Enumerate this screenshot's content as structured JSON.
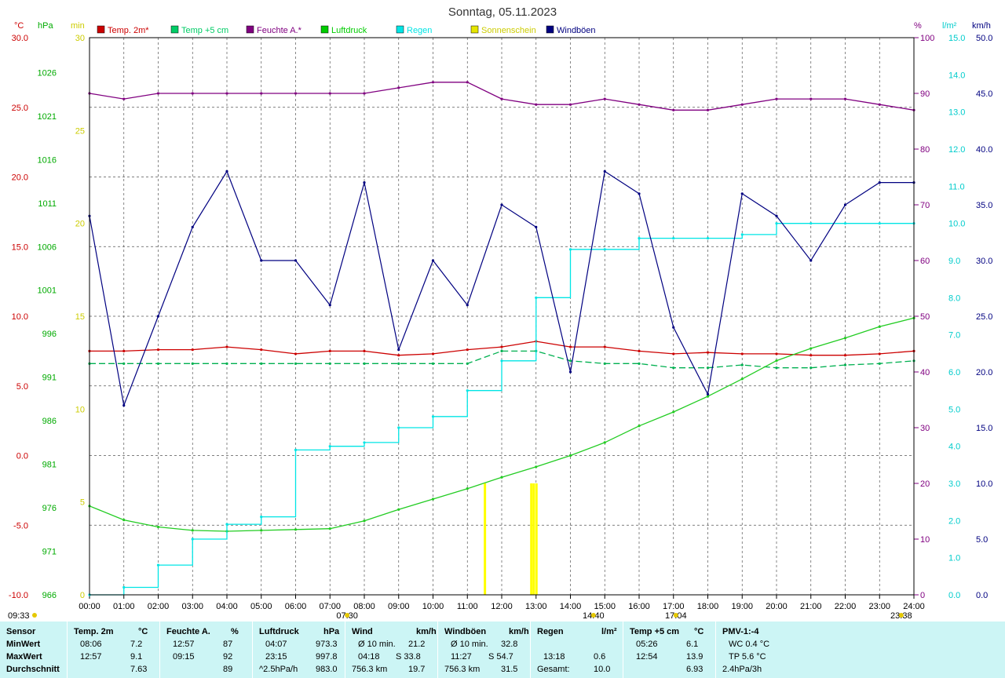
{
  "title": "Sonntag, 05.11.2023",
  "axis_units": {
    "temp": "°C",
    "pressure": "hPa",
    "sun": "min",
    "humidity": "%",
    "rain": "l/m²",
    "wind": "km/h"
  },
  "axis_labels": {
    "temp": [
      "30.0",
      "25.0",
      "20.0",
      "15.0",
      "10.0",
      "5.0",
      "0.0",
      "-5.0",
      "-10.0"
    ],
    "pressure": [
      "1026",
      "1021",
      "1016",
      "1011",
      "1006",
      "1001",
      "996",
      "991",
      "986",
      "981",
      "976",
      "971",
      "966"
    ],
    "sun": [
      "30",
      "25",
      "20",
      "15",
      "10",
      "5",
      "0"
    ],
    "humidity": [
      "100",
      "90",
      "80",
      "70",
      "60",
      "50",
      "40",
      "30",
      "20",
      "10",
      "0"
    ],
    "rain": [
      "15.0",
      "14.0",
      "13.0",
      "12.0",
      "11.0",
      "10.0",
      "9.0",
      "8.0",
      "7.0",
      "6.0",
      "5.0",
      "4.0",
      "3.0",
      "2.0",
      "1.0",
      "0.0"
    ],
    "wind": [
      "50.0",
      "45.0",
      "40.0",
      "35.0",
      "30.0",
      "25.0",
      "20.0",
      "15.0",
      "10.0",
      "5.0",
      "0.0"
    ]
  },
  "x_ticks": [
    "00:00",
    "01:00",
    "02:00",
    "03:00",
    "04:00",
    "05:00",
    "06:00",
    "07:00",
    "08:00",
    "09:00",
    "10:00",
    "11:00",
    "12:00",
    "13:00",
    "14:00",
    "15:00",
    "16:00",
    "17:00",
    "18:00",
    "19:00",
    "20:00",
    "21:00",
    "22:00",
    "23:00",
    "24:00"
  ],
  "x_annotations": [
    {
      "label": "07:30",
      "hour": 7.5
    },
    {
      "label": "17:04",
      "hour": 17.07
    },
    {
      "label": "14:40",
      "hour": 14.67
    },
    {
      "label": "23:38",
      "hour": 23.63
    }
  ],
  "x_left_note": "09:33",
  "colors": {
    "temp2m": "#cc0000",
    "temp5cm": "#00b050",
    "humidity": "#800080",
    "pressure": "#22cc22",
    "rain": "#00e5e5",
    "sun": "#ffff00",
    "gusts": "#000080",
    "grid": "#808080",
    "panel": "#ccf5f5"
  },
  "legend": [
    {
      "label": "Temp. 2m*",
      "color": "#cc0000"
    },
    {
      "label": "Temp +5 cm",
      "color": "#00cc66"
    },
    {
      "label": "Feuchte A.*",
      "color": "#800080"
    },
    {
      "label": "Luftdruck",
      "color": "#00cc00"
    },
    {
      "label": "Regen",
      "color": "#00e5e5"
    },
    {
      "label": "Sonnenschein",
      "color": "#e5e500"
    },
    {
      "label": "Windböen",
      "color": "#000080"
    }
  ],
  "chart_data": {
    "type": "line",
    "x": [
      0,
      1,
      2,
      3,
      4,
      5,
      6,
      7,
      8,
      9,
      10,
      11,
      12,
      13,
      14,
      15,
      16,
      17,
      18,
      19,
      20,
      21,
      22,
      23,
      24
    ],
    "xlabel": "",
    "series": [
      {
        "name": "Temp. 2m*",
        "axis": "temp",
        "values": [
          7.5,
          7.5,
          7.6,
          7.6,
          7.8,
          7.6,
          7.3,
          7.5,
          7.5,
          7.2,
          7.3,
          7.6,
          7.8,
          8.2,
          7.8,
          7.8,
          7.5,
          7.3,
          7.4,
          7.3,
          7.3,
          7.2,
          7.2,
          7.3,
          7.5
        ]
      },
      {
        "name": "Temp +5 cm",
        "axis": "temp",
        "values": [
          6.6,
          6.6,
          6.6,
          6.6,
          6.6,
          6.6,
          6.6,
          6.6,
          6.6,
          6.6,
          6.6,
          6.6,
          7.5,
          7.5,
          6.8,
          6.6,
          6.6,
          6.3,
          6.3,
          6.5,
          6.3,
          6.3,
          6.5,
          6.6,
          6.8
        ]
      },
      {
        "name": "Feuchte A.*",
        "axis": "humidity",
        "values": [
          90,
          89,
          90,
          90,
          90,
          90,
          90,
          90,
          90,
          91,
          92,
          92,
          89,
          88,
          88,
          89,
          88,
          87,
          87,
          88,
          89,
          89,
          89,
          88,
          87
        ]
      },
      {
        "name": "Luftdruck",
        "axis": "pressure",
        "values": [
          976.2,
          974.6,
          973.8,
          973.4,
          973.3,
          973.4,
          973.5,
          973.6,
          974.5,
          975.8,
          977.0,
          978.2,
          979.5,
          980.7,
          982.0,
          983.5,
          985.4,
          987.0,
          988.8,
          990.8,
          992.9,
          994.3,
          995.5,
          996.8,
          997.8
        ]
      },
      {
        "name": "Regen",
        "axis": "rain",
        "values": [
          0.0,
          0.2,
          0.8,
          1.5,
          1.9,
          2.1,
          3.9,
          4.0,
          4.1,
          4.5,
          4.8,
          5.5,
          6.3,
          8.0,
          9.3,
          9.3,
          9.6,
          9.6,
          9.6,
          9.7,
          10.0,
          10.0,
          10.0,
          10.0,
          10.0
        ]
      },
      {
        "name": "Windböen",
        "axis": "wind",
        "values": [
          34,
          17,
          25,
          33,
          38,
          30,
          30,
          26,
          37,
          22,
          30,
          26,
          35,
          33,
          20,
          38,
          36,
          24,
          18,
          36,
          34,
          30,
          35,
          37,
          37
        ]
      }
    ],
    "sunshine_bars": [
      {
        "hour": 11.5,
        "minutes": 6
      },
      {
        "hour": 12.85,
        "minutes": 6
      },
      {
        "hour": 12.92,
        "minutes": 6
      },
      {
        "hour": 13.0,
        "minutes": 6
      }
    ],
    "axes": {
      "temp": {
        "range": [
          -10,
          30
        ],
        "label": "°C"
      },
      "pressure": {
        "range": [
          966,
          1030
        ],
        "label": "hPa"
      },
      "sun": {
        "range": [
          0,
          30
        ],
        "label": "min"
      },
      "humidity": {
        "range": [
          0,
          100
        ],
        "label": "%"
      },
      "rain": {
        "range": [
          0,
          15
        ],
        "label": "l/m²"
      },
      "wind": {
        "range": [
          0,
          50
        ],
        "label": "km/h"
      }
    }
  },
  "stats": {
    "row_labels": [
      "Sensor",
      "MinWert",
      "MaxWert",
      "Durchschnitt"
    ],
    "blocks": [
      {
        "name": "Temp. 2m",
        "unit": "°C",
        "min_time": "08:06",
        "min_val": "7.2",
        "max_time": "12:57",
        "max_val": "9.1",
        "avg_label": "",
        "avg_val": "7.63"
      },
      {
        "name": "Feuchte A.",
        "unit": "%",
        "min_time": "12:57",
        "min_val": "87",
        "max_time": "09:15",
        "max_val": "92",
        "avg_label": "",
        "avg_val": "89"
      },
      {
        "name": "Luftdruck",
        "unit": "hPa",
        "min_time": "04:07",
        "min_val": "973.3",
        "max_time": "23:15",
        "max_val": "997.8",
        "avg_label": "^2.5hPa/h",
        "avg_val": "983.0"
      },
      {
        "name": "Wind",
        "unit": "km/h",
        "min_time": "Ø 10 min.",
        "min_val": "21.2",
        "max_time": "04:18",
        "max_mid": "S 33.8",
        "max_val": "",
        "avg_label": "756.3 km",
        "avg_val": "19.7"
      },
      {
        "name": "Windböen",
        "unit": "km/h",
        "min_time": "Ø 10 min.",
        "min_val": "32.8",
        "max_time": "11:27",
        "max_mid": "S 54.7",
        "max_val": "",
        "avg_label": "756.3 km",
        "avg_val": "31.5"
      },
      {
        "name": "Regen",
        "unit": "l/m²",
        "min_time": "",
        "min_val": "",
        "max_time": "13:18",
        "max_val": "0.6",
        "avg_label": "Gesamt:",
        "avg_val": "10.0"
      },
      {
        "name": "Temp +5 cm",
        "unit": "°C",
        "min_time": "05:26",
        "min_val": "6.1",
        "max_time": "12:54",
        "max_val": "13.9",
        "avg_label": "",
        "avg_val": "6.93"
      },
      {
        "name": "PMV-1:-4",
        "unit": "",
        "min_time": "WC 0.4 °C",
        "min_val": "",
        "max_time": "TP 5.6 °C",
        "max_val": "",
        "avg_label": "2.4hPa/3h",
        "avg_val": ""
      }
    ]
  }
}
